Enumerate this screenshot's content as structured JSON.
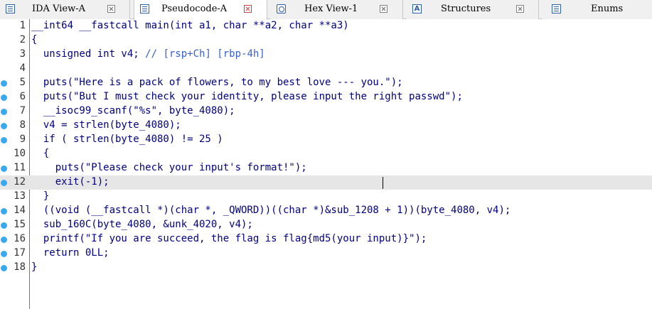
{
  "tabs": [
    {
      "label": "IDA View-A",
      "icon": "ida-view-icon",
      "active": false
    },
    {
      "label": "Pseudocode-A",
      "icon": "pseudocode-icon",
      "active": true
    },
    {
      "label": "Hex View-1",
      "icon": "hex-view-icon",
      "active": false
    },
    {
      "label": "Structures",
      "icon": "structures-icon",
      "glyph": "A",
      "active": false
    },
    {
      "label": "Enums",
      "icon": "enums-icon",
      "active": false
    }
  ],
  "code": {
    "line_numbers": [
      "1",
      "2",
      "3",
      "4",
      "5",
      "6",
      "7",
      "8",
      "9",
      "10",
      "11",
      "12",
      "13",
      "14",
      "15",
      "16",
      "17",
      "18"
    ],
    "breakpoint_lines": [
      5,
      6,
      7,
      8,
      9,
      11,
      12,
      14,
      15,
      16,
      17,
      18
    ],
    "current_line": 12,
    "lines": [
      "__int64 __fastcall main(int a1, char **a2, char **a3)",
      "{",
      "  unsigned int v4; // [rsp+Ch] [rbp-4h]",
      "",
      "  puts(\"Here is a pack of flowers, to my best love --- you.\");",
      "  puts(\"But I must check your identity, please input the right passwd\");",
      "  __isoc99_scanf(\"%s\", byte_4080);",
      "  v4 = strlen(byte_4080);",
      "  if ( strlen(byte_4080) != 25 )",
      "  {",
      "    puts(\"Please check your input's format!\");",
      "    exit(-1);",
      "  }",
      "  ((void (__fastcall *)(char *, _QWORD))((char *)&sub_1208 + 1))(byte_4080, v4);",
      "  sub_160C(byte_4080, &unk_4020, v4);",
      "  printf(\"If you are succeed, the flag is flag{md5(your input)}\");",
      "  return 0LL;",
      "}"
    ]
  },
  "colors": {
    "code_text": "#000080",
    "comment": "#3a5fd0",
    "breakpoint": "#38a8f0",
    "current_line_bg": "#e6e6e6",
    "gutter_border": "#4a7fc0"
  }
}
